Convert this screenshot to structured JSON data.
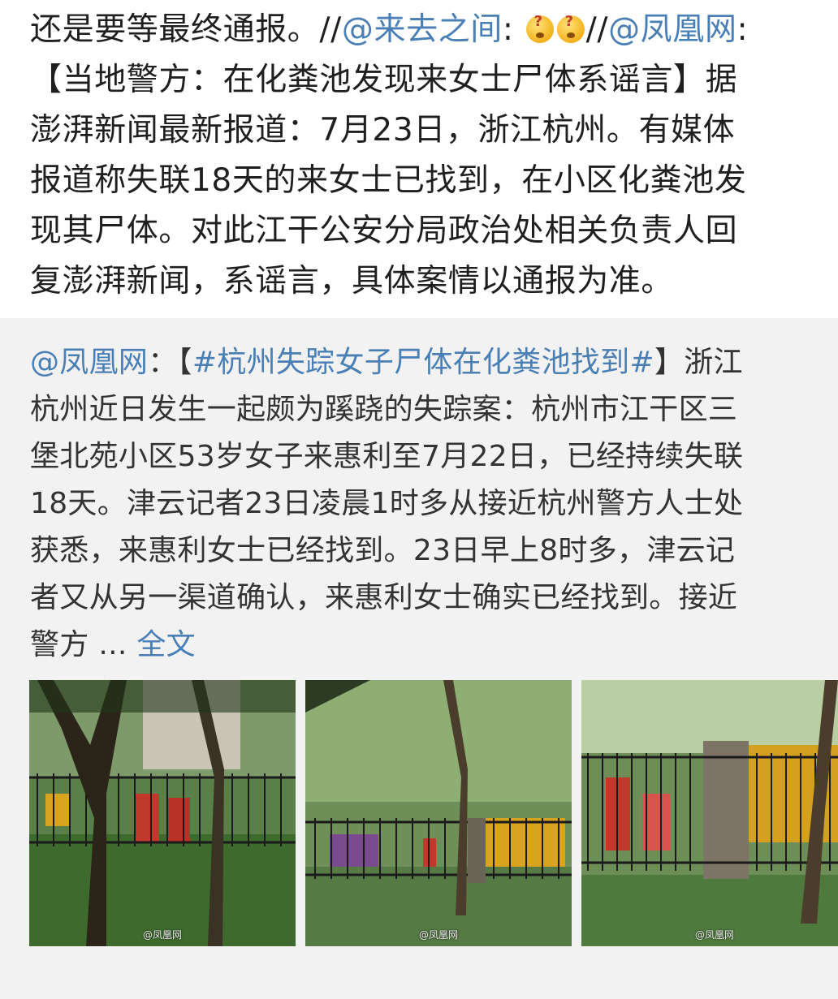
{
  "post": {
    "lines": [
      {
        "parts": [
          {
            "text": "还是要等最终通报。//"
          },
          {
            "text": "@来去之间",
            "link": true
          },
          {
            "text": ": "
          },
          {
            "emoji": "confused-emoji"
          },
          {
            "emoji": "confused-emoji"
          },
          {
            "text": "//"
          },
          {
            "text": "@凤凰网",
            "link": true
          },
          {
            "text": ":"
          }
        ]
      },
      {
        "parts": [
          {
            "text": "【当地警方：在化粪池发现来女士尸体系谣言】据"
          }
        ]
      },
      {
        "parts": [
          {
            "text": "澎湃新闻最新报道：7月23日，浙江杭州。有媒体"
          }
        ]
      },
      {
        "parts": [
          {
            "text": "报道称失联18天的来女士已找到，在小区化粪池发"
          }
        ]
      },
      {
        "parts": [
          {
            "text": "现其尸体。对此江干公安分局政治处相关负责人回"
          }
        ]
      },
      {
        "parts": [
          {
            "text": "复澎湃新闻，系谣言，具体案情以通报为准。"
          }
        ]
      }
    ]
  },
  "repost": {
    "lines": [
      {
        "parts": [
          {
            "text": "@凤凰网",
            "link": true
          },
          {
            "text": "：【"
          },
          {
            "text": "#杭州失踪女子尸体在化粪池找到#",
            "link": true
          },
          {
            "text": "】浙江"
          }
        ]
      },
      {
        "parts": [
          {
            "text": "杭州近日发生一起颇为蹊跷的失踪案：杭州市江干区三"
          }
        ]
      },
      {
        "parts": [
          {
            "text": "堡北苑小区53岁女子来惠利至7月22日，已经持续失联"
          }
        ]
      },
      {
        "parts": [
          {
            "text": "18天。津云记者23日凌晨1时多从接近杭州警方人士处"
          }
        ]
      },
      {
        "parts": [
          {
            "text": "获悉，来惠利女士已经找到。23日早上8时多，津云记"
          }
        ]
      },
      {
        "parts": [
          {
            "text": "者又从另一渠道确认，来惠利女士确实已经找到。接近"
          }
        ]
      },
      {
        "parts": [
          {
            "text": "警方 ... "
          },
          {
            "text": "全文",
            "link": true,
            "interactable": true
          }
        ]
      }
    ],
    "images": [
      {
        "watermark": "@凤凰网"
      },
      {
        "watermark": "@凤凰网"
      },
      {
        "watermark": "@凤凰网"
      }
    ]
  },
  "colors": {
    "link": "#4a7fb5",
    "text": "#1f1f1f",
    "repost_background": "#f2f2f2",
    "repost_text": "#333333"
  }
}
